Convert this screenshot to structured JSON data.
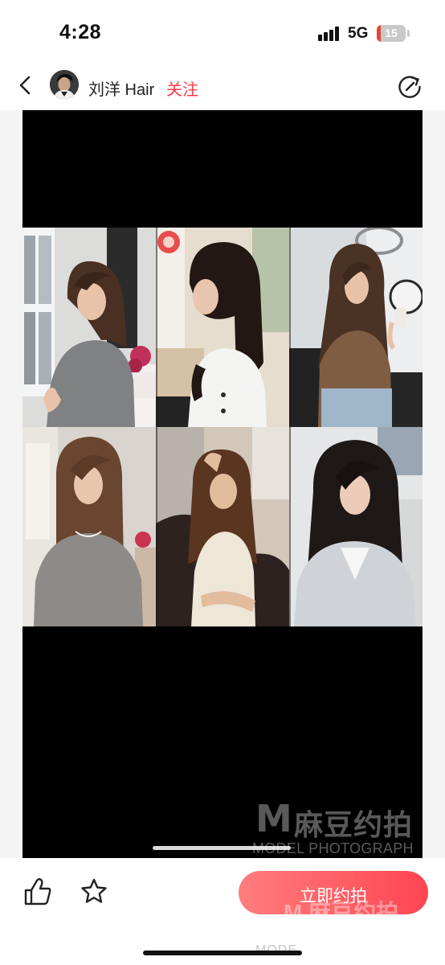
{
  "status_bar": {
    "time": "4:28",
    "network": "5G",
    "battery_level": "15",
    "battery_fraction": 0.15,
    "battery_color": "#e4453a"
  },
  "header": {
    "back_icon": "chevron-left-icon",
    "author_name": "刘洋 Hair",
    "follow_label": "关注",
    "follow_color": "#ff3b47",
    "share_icon": "share-icon"
  },
  "gallery": {
    "photos": [
      {
        "hair": "medium layered brown hair, grey knit top"
      },
      {
        "hair": "long layered dark hair, white blouse"
      },
      {
        "hair": "long wavy brown hair, brown top"
      },
      {
        "hair": "straight shoulder hair, grey top"
      },
      {
        "hair": "long curled hair, cream outfit"
      },
      {
        "hair": "long wavy black hair, light blazer"
      }
    ]
  },
  "watermark": {
    "logo_letter": "M",
    "brand_cn": "麻豆约拍",
    "brand_en": "MODEL PHOTOGRAPH"
  },
  "bottom_bar": {
    "like_icon": "thumbs-up-icon",
    "favorite_icon": "star-icon",
    "book_label": "立即约拍",
    "book_watermark": "M 麻豆约拍",
    "faint_text": "MODE"
  }
}
